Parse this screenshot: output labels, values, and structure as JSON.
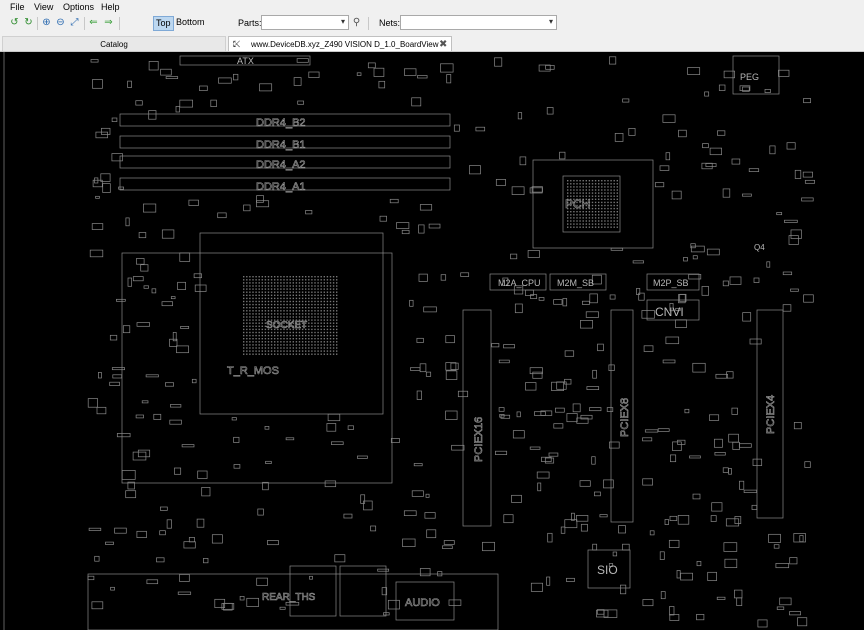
{
  "menu": {
    "file": "File",
    "view": "View",
    "options": "Options",
    "help": "Help"
  },
  "toolbar": {
    "top_label": "Top",
    "bottom_label": "Bottom",
    "parts_label": "Parts:",
    "parts_value": "",
    "nets_label": "Nets:",
    "nets_value": ""
  },
  "tabs": {
    "catalog": "Catalog",
    "board_file": "www.DeviceDB.xyz_Z490 VISION D_1.0_BoardView"
  },
  "board": {
    "atx": "ATX",
    "ddr_b2": "DDR4_B2",
    "ddr_b1": "DDR4_B1",
    "ddr_a2": "DDR4_A2",
    "ddr_a1": "DDR4_A1",
    "pch": "PCH",
    "socket": "SOCKET",
    "t_r_mos": "T_R_MOS",
    "m2a_cpu": "M2A_CPU",
    "m2m_sb": "M2M_SB",
    "m2p_sb": "M2P_SB",
    "cnvi": "CNVI",
    "pciex16": "PCIEX16",
    "pciex8": "PCIEX8",
    "pciex4": "PCIEX4",
    "sio": "SIO",
    "audio": "AUDIO",
    "peg": "PEG",
    "q4": "Q4",
    "rear_ths": "REAR_THS"
  },
  "colors": {
    "canvas": "#000000",
    "outline": "#9a9a9a",
    "active_side": "#bcd7f0"
  }
}
